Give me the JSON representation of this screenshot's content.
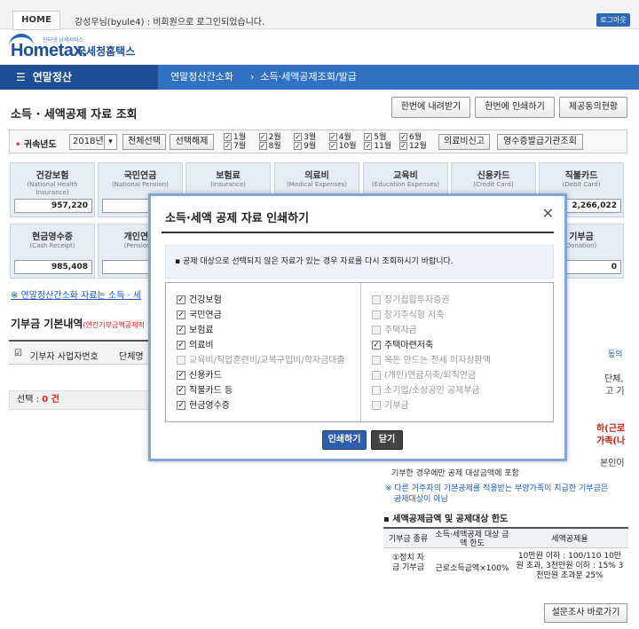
{
  "topbar": {
    "home_label": "HOME",
    "login_message": "강성우님(byule4) : 비회원으로 로그인되었습니다.",
    "logout_label": "로그아웃"
  },
  "logo": {
    "brand": "Hometax.",
    "korean": "국세청홈택스",
    "tagline": "인터넷 납세서비스"
  },
  "nav": {
    "main_label": "연말정산",
    "crumbs": [
      "연말정산간소화",
      "소득·세액공제조회/발급"
    ]
  },
  "page": {
    "title": "소득 · 세액공제 자료 조회",
    "buttons": [
      "한번에 내려받기",
      "한번에 인쇄하기",
      "제공동의현황"
    ]
  },
  "filter": {
    "year_label": "귀속년도",
    "year_value": "2018년",
    "select_all": "전체선택",
    "deselect": "선택해제",
    "months_top": [
      "1월",
      "2월",
      "3월",
      "4월",
      "5월",
      "6월"
    ],
    "months_bottom": [
      "7월",
      "8월",
      "9월",
      "10월",
      "11월",
      "12월"
    ],
    "medical_report": "의료비신고",
    "receipt_issuer": "영수증발급기관조회"
  },
  "cards": [
    {
      "name": "건강보험",
      "en": "(National Health Insurance)",
      "value": "957,220"
    },
    {
      "name": "국민연금",
      "en": "(National Pension)",
      "value": ""
    },
    {
      "name": "보험료",
      "en": "(Insurance)",
      "value": ""
    },
    {
      "name": "의료비",
      "en": "(Medical Expenses)",
      "value": ""
    },
    {
      "name": "교육비",
      "en": "(Education Expenses)",
      "value": ""
    },
    {
      "name": "신용카드",
      "en": "(Credit Card)",
      "value": ""
    },
    {
      "name": "직불카드",
      "en": "(Debit Card)",
      "value": "2,266,022"
    },
    {
      "name": "현금영수증",
      "en": "(Cash Receipt)",
      "value": "985,408"
    },
    {
      "name": "개인연금",
      "en": "(Pension S",
      "value": ""
    },
    {
      "name": "기부금",
      "en": "Donation)",
      "value": "0"
    }
  ],
  "note_link": "※ 연말정산간소화 자료는 소득 · 세",
  "donation": {
    "title": "기부금 기본내역",
    "subtitle": "(연간기부금액공제적",
    "col_donor_id": "기부자 사업자번호",
    "col_group": "단체명",
    "selected_label": "선택 :",
    "selected_count": "0 건"
  },
  "right_panel": {
    "snippets": [
      "동의",
      "단체,",
      "고 기",
      "하(근로",
      "가족(나",
      "본인이"
    ],
    "line1": "기부한 경우에만 공제 대상금액에 포함",
    "blue_note_1": "※ 다른 거주자의 기본공제를 적용받는 부양가족이 지급한 기부금은",
    "blue_note_2": "공제대상이 아님",
    "table_title": "▪ 세액공제금액 및 공제대상 한도",
    "th1": "기부금 종류",
    "th2": "소득·세액공제 대상 금액 한도",
    "th3": "세액공제율",
    "row_type": "①정치 자금 기부금",
    "row_limit": "근로소득금액×100%",
    "row_rate": "10만원 이하 : 100/110 10만원 초과, 3천만원 이하 : 15% 3천만원 초과분 25%",
    "survey_label": "설문조사 바로가기"
  },
  "dialog": {
    "title": "소득·세액 공제 자료 인쇄하기",
    "notice": "▪ 공제 대상으로 선택되지 않은 자료가 있는 경우 자료를 다시 조회하시기 바랍니다.",
    "left_options": [
      {
        "label": "건강보험",
        "checked": true,
        "disabled": false
      },
      {
        "label": "국민연금",
        "checked": true,
        "disabled": false
      },
      {
        "label": "보험료",
        "checked": true,
        "disabled": false
      },
      {
        "label": "의료비",
        "checked": true,
        "disabled": false
      },
      {
        "label": "교육비/직업훈련비/교복구입비/학자금대출",
        "checked": false,
        "disabled": true
      },
      {
        "label": "신용카드",
        "checked": true,
        "disabled": false
      },
      {
        "label": "직불카드 등",
        "checked": true,
        "disabled": false
      },
      {
        "label": "현금영수증",
        "checked": true,
        "disabled": false
      }
    ],
    "right_options": [
      {
        "label": "장기집합투자증권",
        "checked": false,
        "disabled": true
      },
      {
        "label": "장기주식형 저축",
        "checked": false,
        "disabled": true
      },
      {
        "label": "주택자금",
        "checked": false,
        "disabled": true
      },
      {
        "label": "주택마련저축",
        "checked": true,
        "disabled": false
      },
      {
        "label": "목돈 안드는 전세 이자상환액",
        "checked": false,
        "disabled": true
      },
      {
        "label": "(개인)연금저축/퇴직연금",
        "checked": false,
        "disabled": true
      },
      {
        "label": "소기업/소상공인 공제부금",
        "checked": false,
        "disabled": true
      },
      {
        "label": "기부금",
        "checked": false,
        "disabled": true
      }
    ],
    "print_label": "인쇄하기",
    "close_label": "닫기"
  },
  "colors": {
    "nav_blue": "#2f72c4",
    "nav_dark": "#1e4f96",
    "print_btn": "#2f5fa8",
    "close_btn": "#444444",
    "dialog_border": "#7ea7d8"
  }
}
